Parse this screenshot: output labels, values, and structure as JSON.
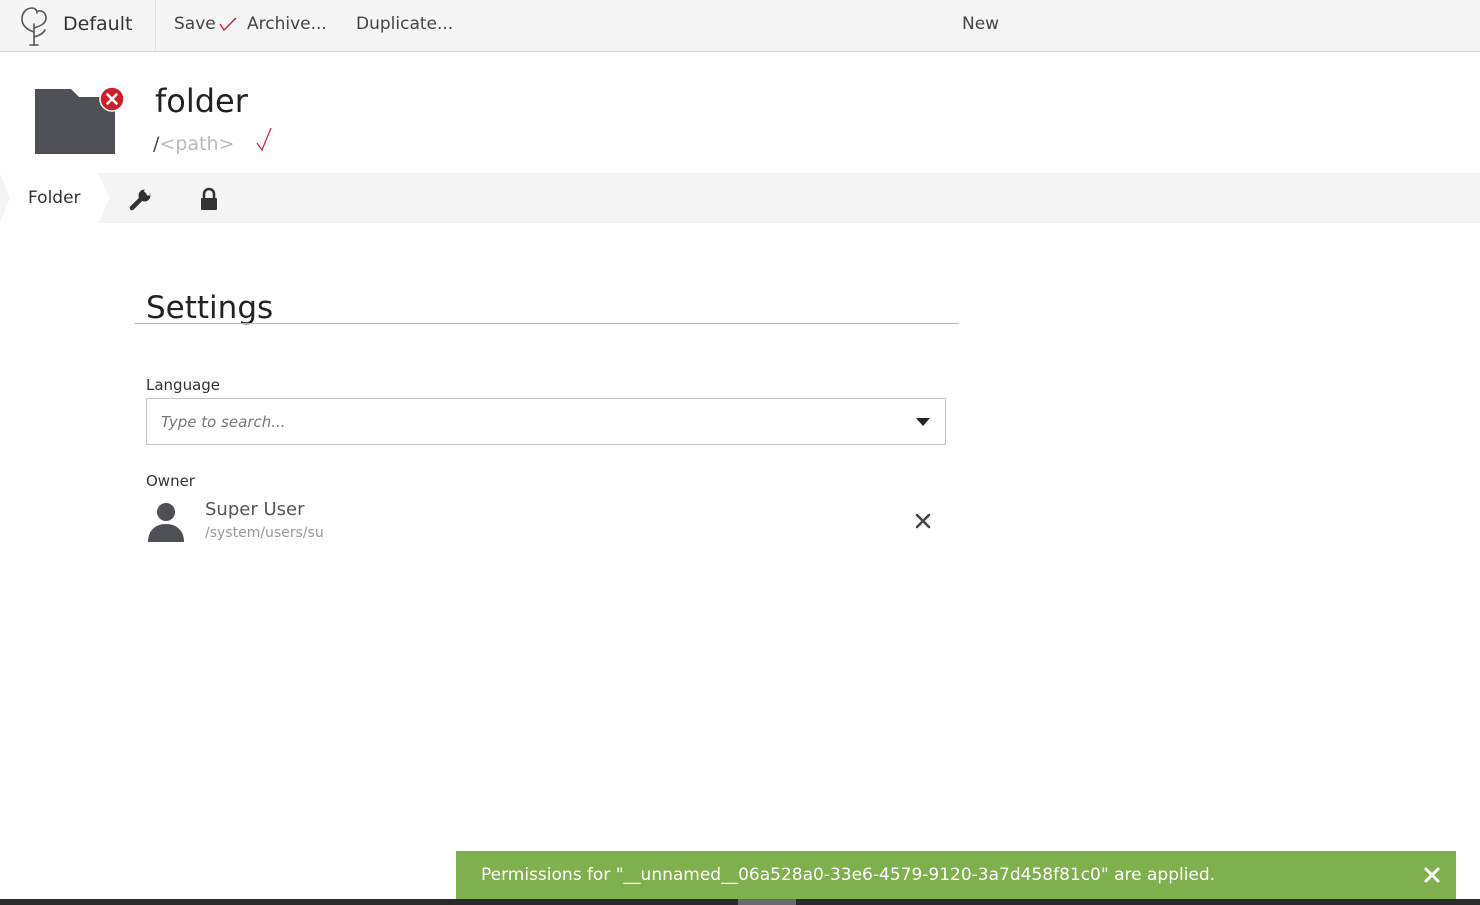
{
  "toolbar": {
    "brand_name": "Default",
    "save_label": "Save",
    "archive_label": "Archive...",
    "duplicate_label": "Duplicate...",
    "new_label": "New"
  },
  "header": {
    "title": "folder",
    "path_prefix": "/",
    "path_placeholder": "<path>",
    "status_icon": "error-x-icon",
    "folder_icon": "folder-icon"
  },
  "tabs": {
    "folder_label": "Folder",
    "settings_icon": "wrench-icon",
    "security_icon": "lock-icon"
  },
  "settings": {
    "title": "Settings",
    "language_label": "Language",
    "language_placeholder": "Type to search...",
    "owner_label": "Owner",
    "owner_name": "Super User",
    "owner_path": "/system/users/su"
  },
  "notification": {
    "message": "Permissions for \"__unnamed__06a528a0-33e6-4579-9120-3a7d458f81c0\" are applied."
  },
  "colors": {
    "toast_bg": "#7fb04e",
    "error_badge": "#cc1f2b",
    "folder_icon": "#4f5055",
    "accent_check": "#cc2233"
  }
}
